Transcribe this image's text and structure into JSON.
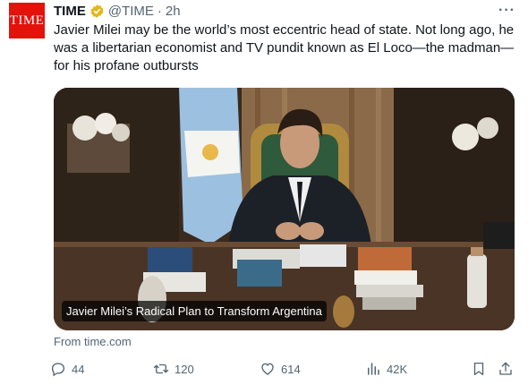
{
  "tweet": {
    "avatar_text": "TIME",
    "author_name": "TIME",
    "handle": "@TIME",
    "separator": "·",
    "time": "2h",
    "more": "···",
    "text": "Javier Milei may be the world’s most eccentric head of state. Not long ago, he was a libertarian economist and TV pundit known as El Loco—the madman—for his profane outbursts",
    "card": {
      "title": "Javier Milei’s Radical Plan to Transform Argentina"
    },
    "source": "From time.com",
    "actions": {
      "replies": "44",
      "reposts": "120",
      "likes": "614",
      "views": "42K"
    }
  },
  "colors": {
    "brand_red": "#e3120b",
    "verified_gold": "#e2b719",
    "muted": "#536471"
  }
}
